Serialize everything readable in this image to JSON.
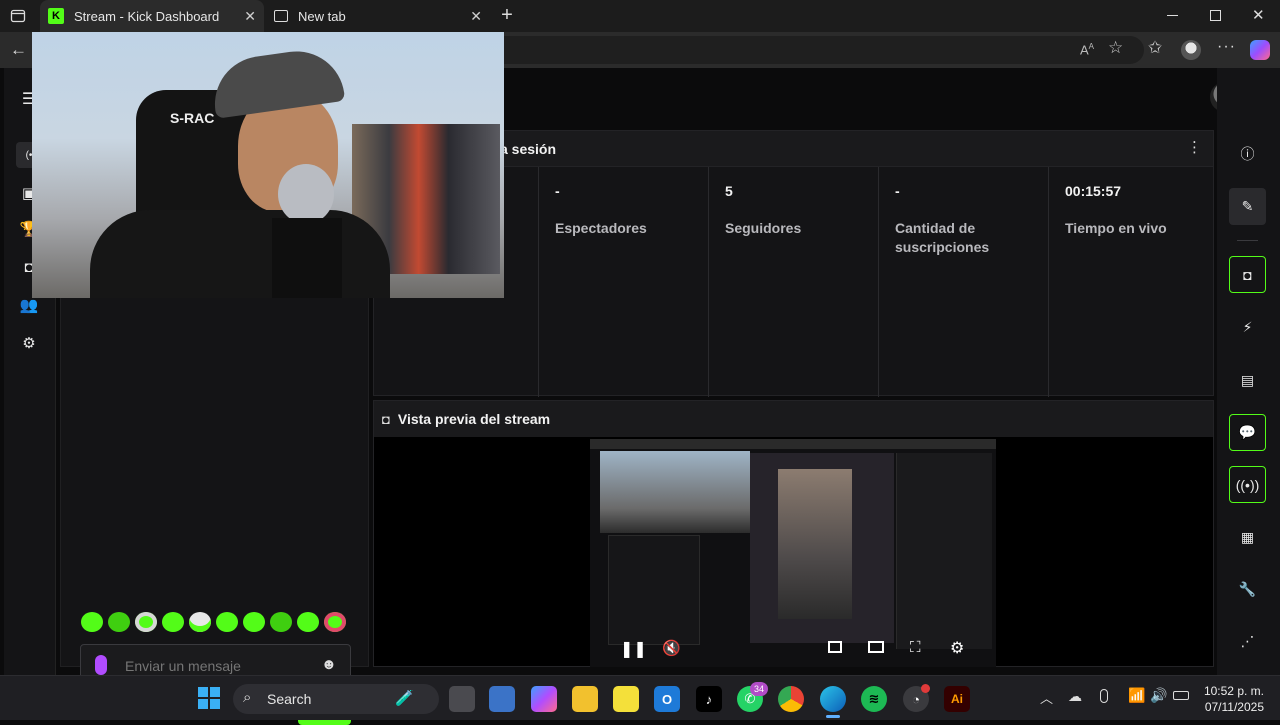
{
  "browser": {
    "tabs": [
      {
        "title": "Stream - Kick Dashboard",
        "active": true
      },
      {
        "title": "New tab",
        "active": false
      }
    ],
    "new_tab_symbol": "+",
    "window_controls": [
      "minimize",
      "maximize",
      "close"
    ]
  },
  "dashboard": {
    "session_title": "a sesión",
    "stats": [
      {
        "value": "-",
        "label": "Espectadores"
      },
      {
        "value": "5",
        "label": "Seguidores"
      },
      {
        "value": "-",
        "label": "Cantidad de suscripciones"
      },
      {
        "value": "00:15:57",
        "label": "Tiempo en vivo"
      }
    ],
    "preview_title": "Vista previa del stream",
    "chat": {
      "placeholder": "Enviar un mensaje",
      "send_label": "Chat"
    }
  },
  "taskbar": {
    "search_label": "Search",
    "whatsapp_badge": "34",
    "clock_time": "10:52 p. m.",
    "clock_date": "07/11/2025"
  },
  "colors": {
    "accent": "#53fc18",
    "panel": "#141416",
    "background": "#0b0b0c"
  }
}
